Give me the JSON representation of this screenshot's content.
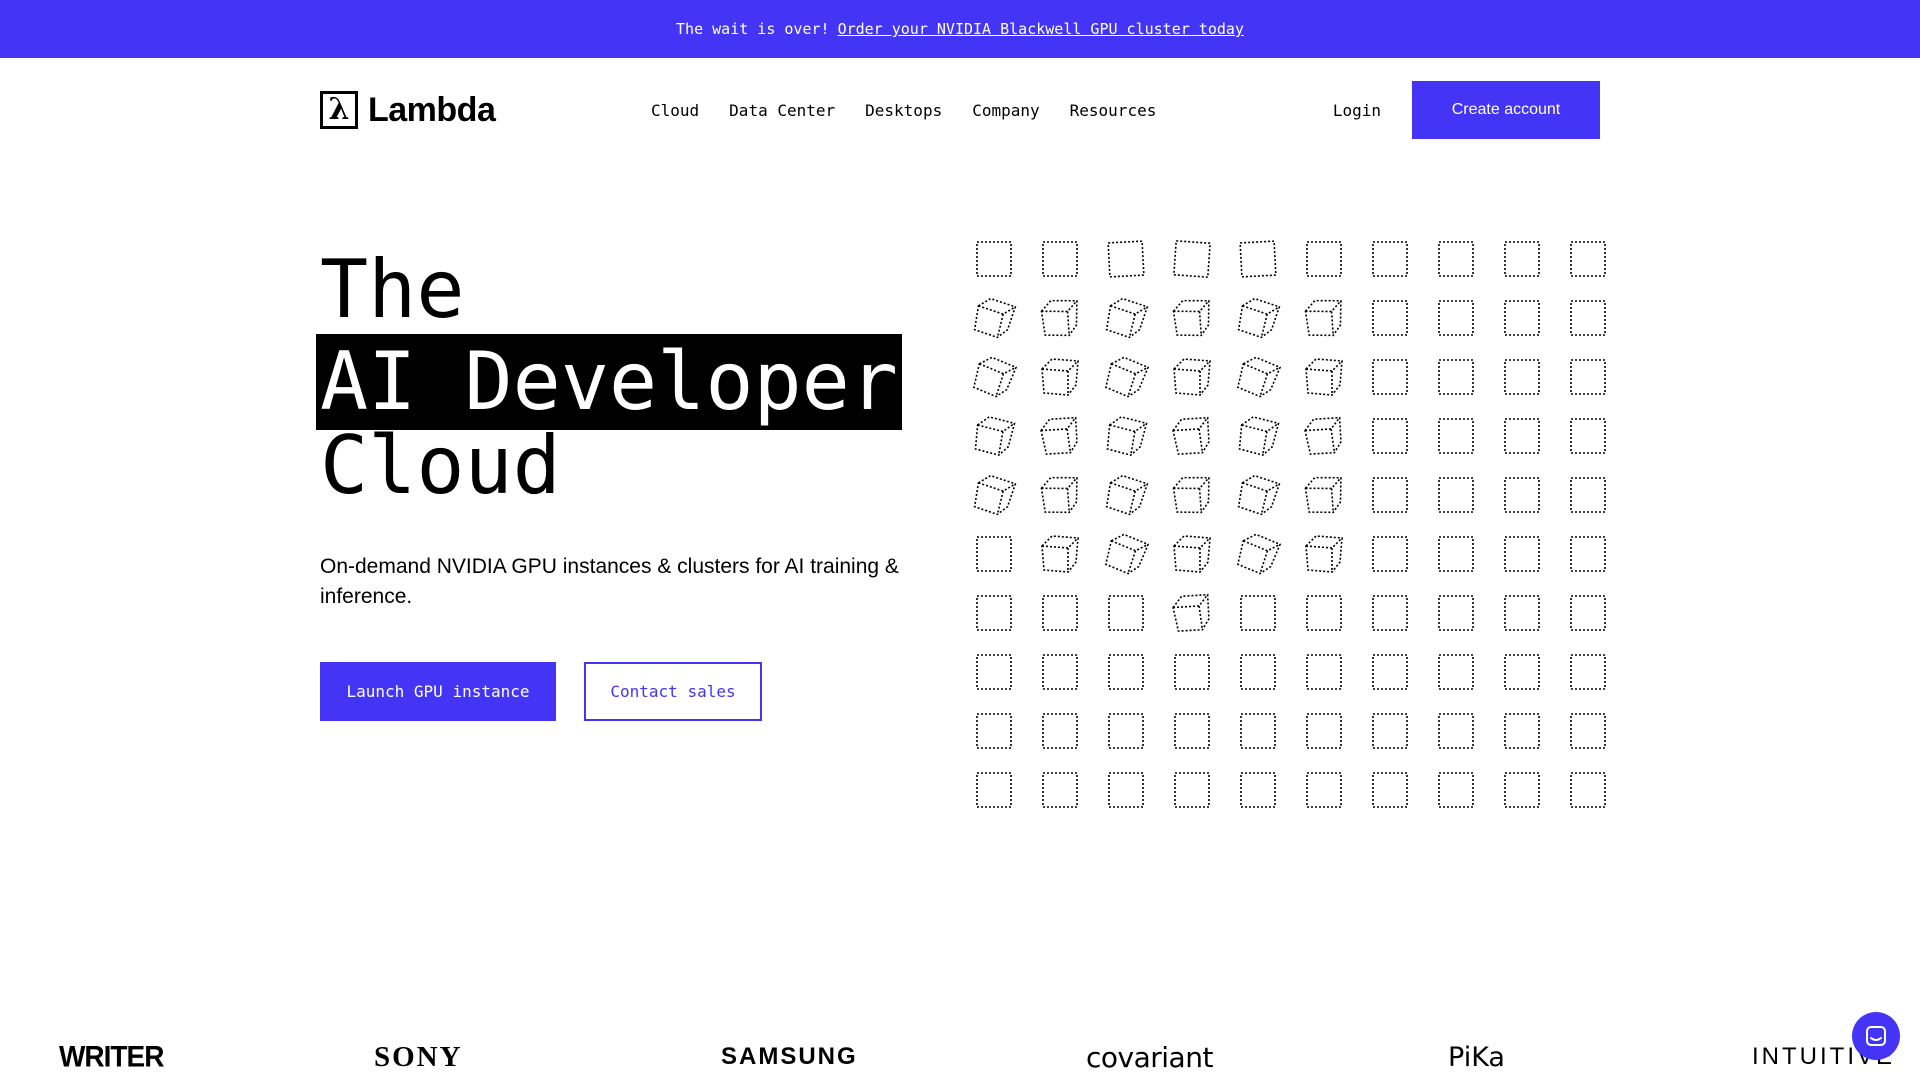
{
  "banner": {
    "text": "The wait is over!",
    "link": "Order your NVIDIA Blackwell GPU cluster today"
  },
  "header": {
    "logo_text": "Lambda",
    "nav": [
      "Cloud",
      "Data Center",
      "Desktops",
      "Company",
      "Resources"
    ],
    "login": "Login",
    "create_account": "Create account"
  },
  "hero": {
    "title_line1": "The",
    "title_line2": "AI Developer",
    "title_line3": "Cloud",
    "subtitle": "On-demand NVIDIA GPU instances & clusters for AI training & inference.",
    "primary_cta": "Launch GPU instance",
    "secondary_cta": "Contact sales"
  },
  "logos": [
    "WRITER",
    "SONY",
    "SAMSUNG",
    "covariant",
    "PiKa",
    "INTUITIVE"
  ],
  "colors": {
    "accent": "#4434f5",
    "text": "#000000",
    "background": "#ffffff"
  },
  "icons": {
    "logo": "lambda-icon",
    "chat": "chat-icon"
  }
}
